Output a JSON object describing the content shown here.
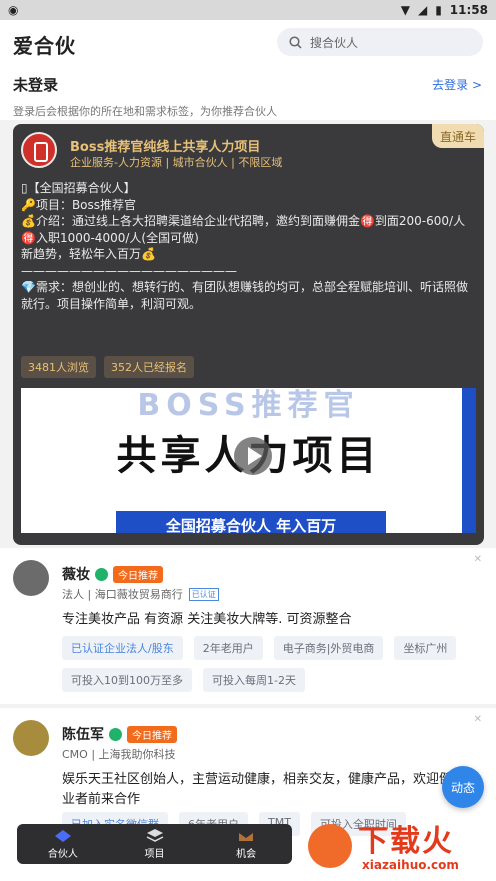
{
  "status": {
    "time": "11:58"
  },
  "header": {
    "logo": "爱合伙",
    "search_placeholder": "搜合伙人"
  },
  "login": {
    "title": "未登录",
    "subtitle": "登录后会根据你的所在地和需求标签，为你推荐合伙人",
    "action": "去登录 >"
  },
  "card": {
    "badge": "直通车",
    "title": "Boss推荐官纯线上共享人力项目",
    "tags": "企业服务-人力资源 | 城市合伙人 | 不限区域",
    "body": "▯【全国招募合伙人】\n🔑项目：Boss推荐官\n💰介绍：通过线上各大招聘渠道给企业代招聘，邀约到面赚佣金🉐到面200-600/人\n🉐入职1000-4000/人(全国可做)\n新趋势，轻松年入百万💰\n——————————————————\n💎需求：想创业的、想转行的、有团队想赚钱的均可，总部全程赋能培训、听话照做就行。项目操作简单，利润可观。",
    "views": "3481人浏览",
    "signups": "352人已经报名",
    "video_line1": "BOSS推荐官",
    "video_line2": "共享人力项目",
    "video_line3": "全国招募合伙人 年入百万"
  },
  "people": [
    {
      "name": "薇妆",
      "badge": "今日推荐",
      "role": "法人 | 海口薇妆贸易商行",
      "cert": "已认证",
      "desc": "专注美妆产品 有资源 关注美妆大牌等. 可资源整合",
      "tags": [
        "已认证企业法人/股东",
        "2年老用户",
        "电子商务|外贸电商",
        "坐标广州",
        "可投入10到100万至多",
        "可投入每周1-2天"
      ]
    },
    {
      "name": "陈伍军",
      "badge": "今日推荐",
      "role": "CMO | 上海我助你科技",
      "desc": "娱乐天王社区创始人，主营运动健康，相亲交友，健康产品，欢迎健康行业者前来合作",
      "tags": [
        "已加入实名微信群",
        "6年老用户",
        "TMT",
        "可投入全职时间"
      ]
    }
  ],
  "tabs": [
    "合伙人",
    "项目",
    "机会"
  ],
  "fab": "动态",
  "watermark": {
    "big": "下载火",
    "small": "xiazaihuo.com"
  }
}
